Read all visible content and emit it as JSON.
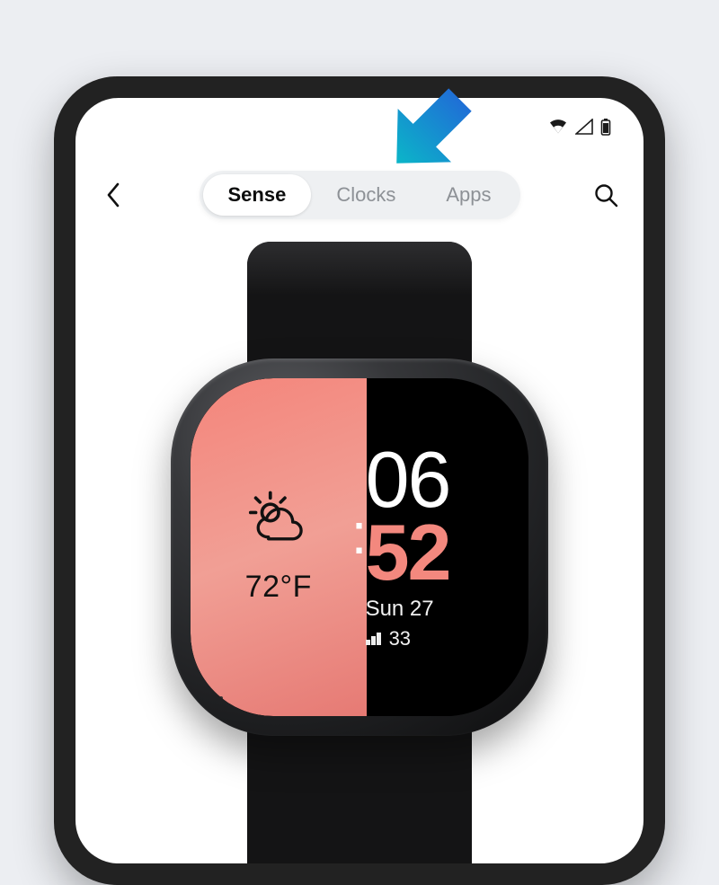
{
  "tabs": {
    "items": [
      {
        "label": "Sense",
        "active": true
      },
      {
        "label": "Clocks",
        "active": false
      },
      {
        "label": "Apps",
        "active": false
      }
    ]
  },
  "watchface": {
    "temperature": "72°F",
    "hours": "06",
    "minutes": "52",
    "date": "Sun 27",
    "floors": "33"
  },
  "colors": {
    "arrow_top": "#1f6fd6",
    "arrow_bottom": "#0bb6c8",
    "accent": "#f3887e"
  }
}
